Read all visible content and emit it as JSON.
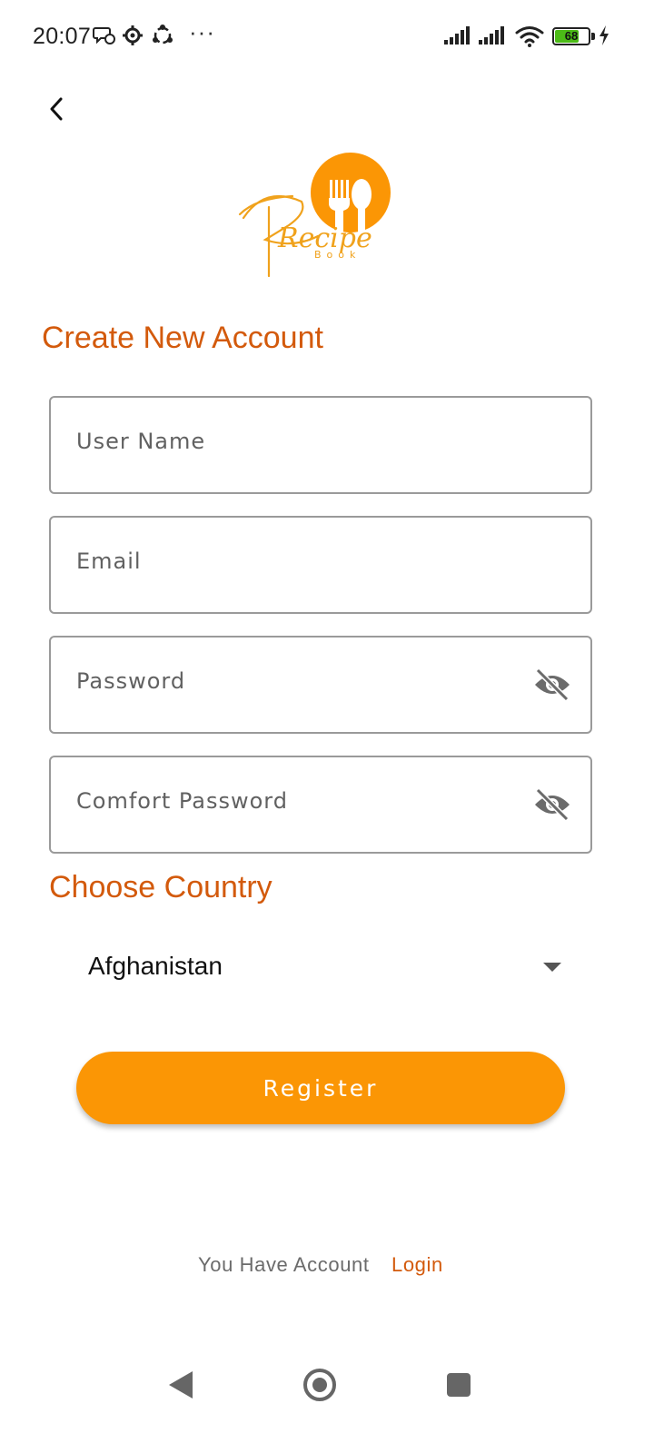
{
  "status_bar": {
    "time": "20:07",
    "battery_level": "68",
    "battery_fraction": 0.68,
    "icons": [
      "chat-icon",
      "settings-gear-icon",
      "sync-icon",
      "more-dots-icon",
      "signal-icon",
      "signal-icon",
      "wifi-icon",
      "battery-icon",
      "charging-icon"
    ],
    "overflow": "···"
  },
  "header": {
    "back_icon": "chevron-left-icon"
  },
  "logo": {
    "word": "Recipe",
    "sub": "Book",
    "accent_color": "#fb9605"
  },
  "form": {
    "title": "Create New Account",
    "username_placeholder": "User Name",
    "email_placeholder": "Email",
    "password_placeholder": "Password",
    "confirm_password_placeholder": "Comfort Password",
    "visibility_icon": "eye-off-icon"
  },
  "country": {
    "heading": "Choose Country",
    "selected": "Afghanistan"
  },
  "register_button": {
    "label": "Register",
    "color": "#fb9605"
  },
  "footer": {
    "prompt": "You Have Account",
    "login_label": "Login",
    "link_color": "#d35a0c"
  },
  "nav_bar": {
    "icons": [
      "back-triangle-icon",
      "home-circle-icon",
      "recents-square-icon"
    ]
  }
}
